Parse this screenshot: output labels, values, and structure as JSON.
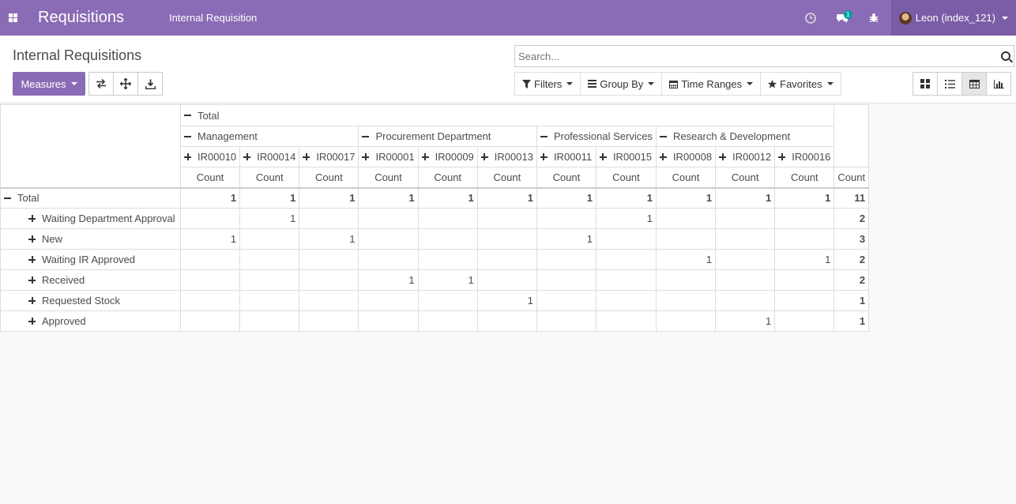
{
  "navbar": {
    "brand": "Requisitions",
    "menu_item": "Internal Requisition",
    "chat_badge": "1",
    "user_name": "Leon (index_121)"
  },
  "control_panel": {
    "title": "Internal Requisitions",
    "search_placeholder": "Search...",
    "measures_label": "Measures",
    "filters_label": "Filters",
    "group_by_label": "Group By",
    "time_ranges_label": "Time Ranges",
    "favorites_label": "Favorites"
  },
  "pivot": {
    "col_total_label": "Total",
    "groups": [
      {
        "label": "Management",
        "items": [
          "IR00010",
          "IR00014",
          "IR00017"
        ]
      },
      {
        "label": "Procurement Department",
        "items": [
          "IR00001",
          "IR00009",
          "IR00013"
        ]
      },
      {
        "label": "Professional Services",
        "items": [
          "IR00011",
          "IR00015"
        ]
      },
      {
        "label": "Research & Development",
        "items": [
          "IR00008",
          "IR00012",
          "IR00016"
        ]
      }
    ],
    "measure_label": "Count",
    "row_total_label": "Total",
    "total_row": [
      "1",
      "1",
      "1",
      "1",
      "1",
      "1",
      "1",
      "1",
      "1",
      "1",
      "1",
      "11"
    ],
    "rows": [
      {
        "label": "Waiting Department Approval",
        "values": [
          "",
          "1",
          "",
          "",
          "",
          "",
          "",
          "1",
          "",
          "",
          "",
          "2"
        ]
      },
      {
        "label": "New",
        "values": [
          "1",
          "",
          "1",
          "",
          "",
          "",
          "1",
          "",
          "",
          "",
          "",
          "3"
        ]
      },
      {
        "label": "Waiting IR Approved",
        "values": [
          "",
          "",
          "",
          "",
          "",
          "",
          "",
          "",
          "1",
          "",
          "1",
          "2"
        ]
      },
      {
        "label": "Received",
        "values": [
          "",
          "",
          "",
          "1",
          "1",
          "",
          "",
          "",
          "",
          "",
          "",
          "2"
        ]
      },
      {
        "label": "Requested Stock",
        "values": [
          "",
          "",
          "",
          "",
          "",
          "1",
          "",
          "",
          "",
          "",
          "",
          "1"
        ]
      },
      {
        "label": "Approved",
        "values": [
          "",
          "",
          "",
          "",
          "",
          "",
          "",
          "",
          "",
          "1",
          "",
          "1"
        ]
      }
    ]
  }
}
